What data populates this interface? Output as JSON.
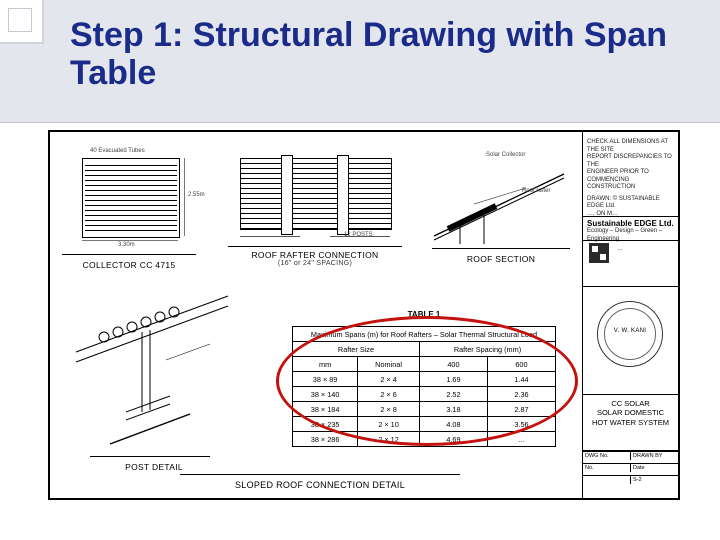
{
  "title": "Step 1: Structural Drawing with Span Table",
  "collector": {
    "caption": "COLLECTOR CC 4715",
    "dimH": "3.30m",
    "dimV": "2.55m",
    "bubble": "40 Evacuated Tubes"
  },
  "rafter": {
    "caption1": "ROOF RAFTER CONNECTION",
    "caption2": "(16\" or 24\" SPACING)",
    "dim": "12 POSTS"
  },
  "roof": {
    "caption": "ROOF SECTION",
    "note1": "Solar Collector",
    "note2": "Roof rafter"
  },
  "post": {
    "caption": "POST DETAIL"
  },
  "sloped": {
    "caption": "SLOPED ROOF CONNECTION DETAIL"
  },
  "notes": {
    "line1": "CHECK ALL DIMENSIONS AT THE SITE",
    "line2": "REPORT DISCREPANCIES TO THE",
    "line3": "ENGINEER PRIOR TO",
    "line4": "COMMENCING CONSTRUCTION",
    "drawn": "DRAWN: © SUSTAINABLE EDGE Ltd.",
    "addr": "…, ON  M…"
  },
  "brand": {
    "name": "Sustainable EDGE Ltd.",
    "tag": "Ecology – Design – Green – Engineering",
    "contact": "…"
  },
  "stamp": {
    "name": "V. W. KANI"
  },
  "project": {
    "l1": "CC SOLAR",
    "l2": "SOLAR DOMESTIC",
    "l3": "HOT WATER SYSTEM"
  },
  "rev": {
    "a": "DWG No.",
    "b": "DRAWN BY",
    "c": "No.",
    "d": "Date",
    "sheet": "S-2"
  },
  "chart_data": {
    "type": "table",
    "title": "TABLE 1",
    "subtitle": "Maximum Spans (m) for Roof Rafters – Solar Thermal Structural Load",
    "col1_top": "Rafter Size",
    "col2_top": "Rafter Spacing (mm)",
    "headers_l": [
      "mm",
      "Nominal"
    ],
    "headers_r": [
      "400",
      "600"
    ],
    "rows": [
      {
        "mm": "38 × 89",
        "nom": "2 × 4",
        "s400": "1.69",
        "s600": "1.44"
      },
      {
        "mm": "38 × 140",
        "nom": "2 × 6",
        "s400": "2.52",
        "s600": "2.36"
      },
      {
        "mm": "38 × 184",
        "nom": "2 × 8",
        "s400": "3.18",
        "s600": "2.87"
      },
      {
        "mm": "38 × 235",
        "nom": "2 × 10",
        "s400": "4.08",
        "s600": "3.56"
      },
      {
        "mm": "38 × 286",
        "nom": "2 × 12",
        "s400": "4.69",
        "s600": "…"
      }
    ]
  }
}
